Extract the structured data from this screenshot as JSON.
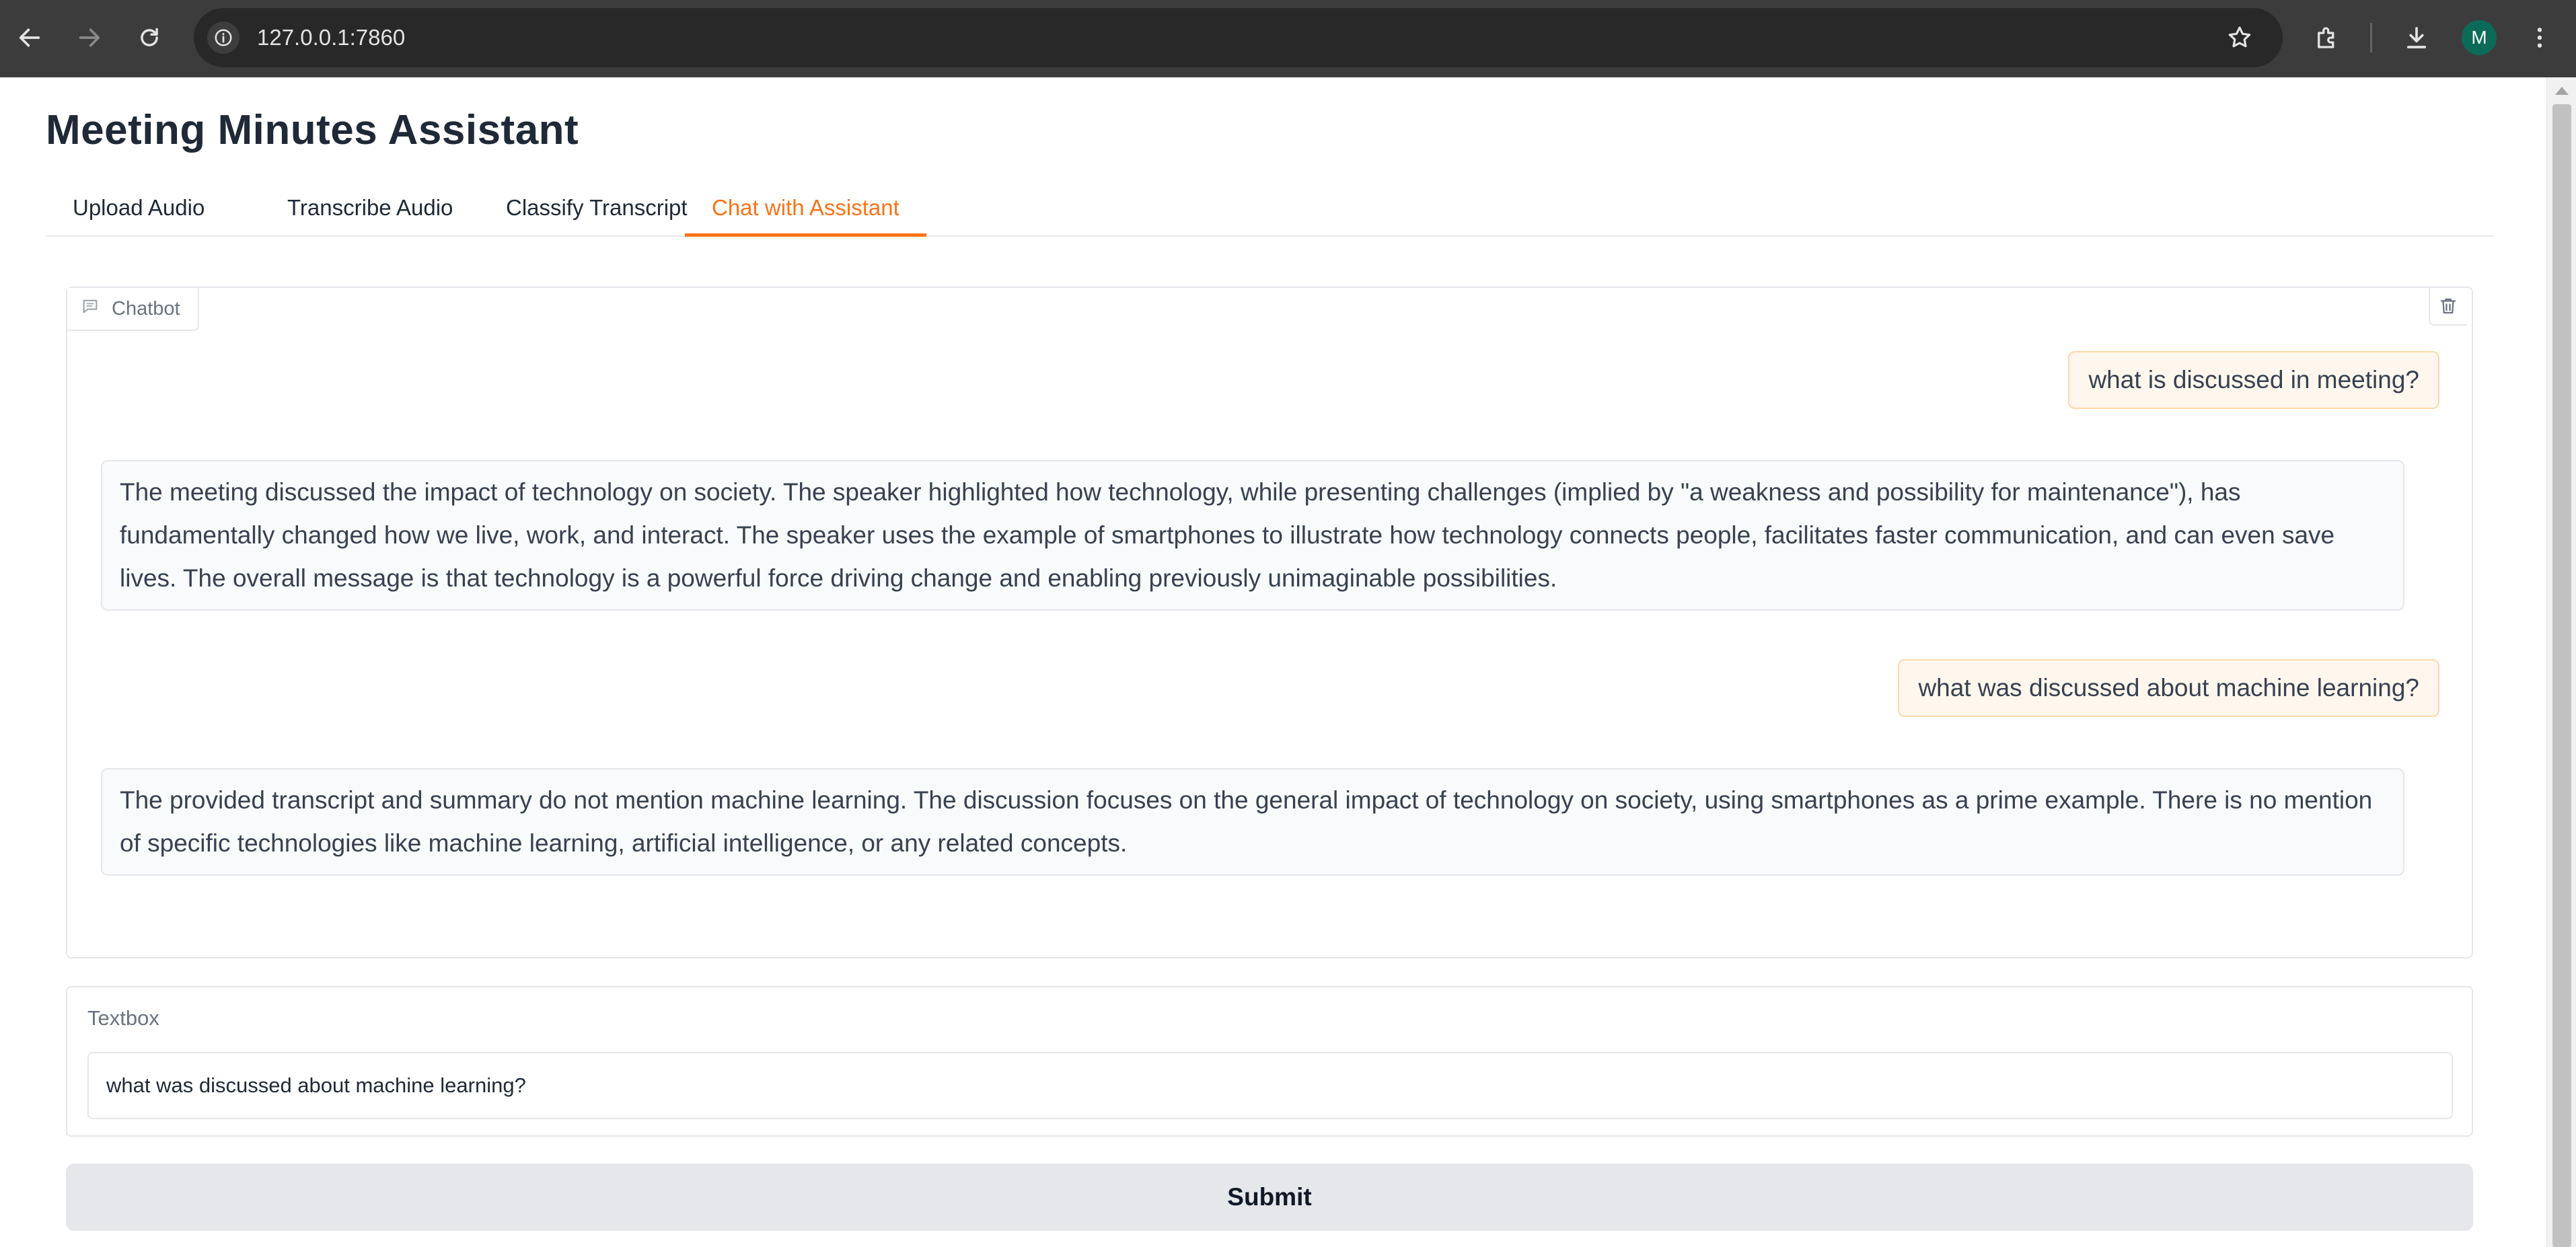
{
  "browser": {
    "url": "127.0.0.1:7860",
    "profile_initial": "M",
    "icons": [
      "back-icon",
      "forward-icon",
      "reload-icon",
      "site-info-icon",
      "bookmark-star-icon",
      "extensions-icon",
      "download-icon",
      "more-menu-icon"
    ]
  },
  "app": {
    "title": "Meeting Minutes Assistant",
    "tabs": [
      {
        "label": "Upload Audio",
        "active": false
      },
      {
        "label": "Transcribe Audio",
        "active": false
      },
      {
        "label": "Classify Transcript",
        "active": false
      },
      {
        "label": "Chat with Assistant",
        "active": true
      }
    ],
    "accent_color": "#f97316"
  },
  "chatbot": {
    "label": "Chatbot",
    "messages": [
      {
        "role": "user",
        "text": "what is discussed in meeting?"
      },
      {
        "role": "assistant",
        "text": "The meeting discussed the impact of technology on society. The speaker highlighted how technology, while presenting challenges (implied by \"a weakness and possibility for maintenance\"), has fundamentally changed how we live, work, and interact. The speaker uses the example of smartphones to illustrate how technology connects people, facilitates faster communication, and can even save lives. The overall message is that technology is a powerful force driving change and enabling previously unimaginable possibilities."
      },
      {
        "role": "user",
        "text": "what was discussed about machine learning?"
      },
      {
        "role": "assistant",
        "text": "The provided transcript and summary do not mention machine learning. The discussion focuses on the general impact of technology on society, using smartphones as a prime example. There is no mention of specific technologies like machine learning, artificial intelligence, or any related concepts."
      }
    ]
  },
  "textbox": {
    "label": "Textbox",
    "value": "what was discussed about machine learning?"
  },
  "submit": {
    "label": "Submit"
  }
}
